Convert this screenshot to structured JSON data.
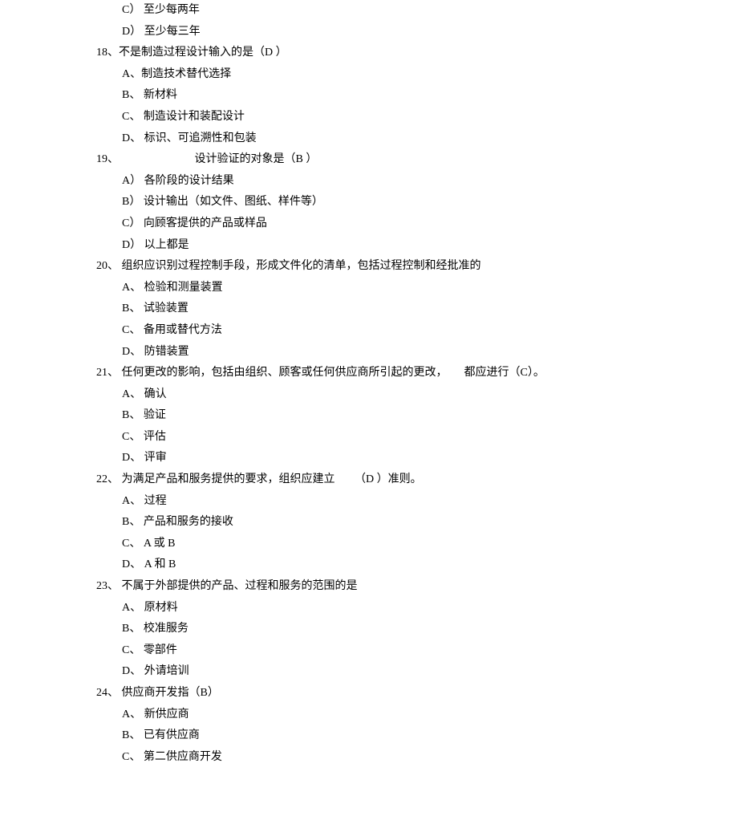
{
  "lines": [
    {
      "cls": "option-pre",
      "text": "C） 至少每两年"
    },
    {
      "cls": "option-pre",
      "text": "D） 至少每三年"
    },
    {
      "cls": "question",
      "text": "18、不是制造过程设计输入的是（D ）"
    },
    {
      "cls": "option",
      "text": "A、制造技术替代选择"
    },
    {
      "cls": "option",
      "text": "B、 新材料"
    },
    {
      "cls": "option",
      "text": "C、 制造设计和装配设计"
    },
    {
      "cls": "option",
      "text": "D、 标识、可追溯性和包装"
    },
    {
      "cls": "question",
      "text": "19、                           设计验证的对象是（B ）"
    },
    {
      "cls": "option",
      "text": "A） 各阶段的设计结果"
    },
    {
      "cls": "option",
      "text": "B） 设计输出（如文件、图纸、样件等）"
    },
    {
      "cls": "option",
      "text": "C） 向顾客提供的产品或样品"
    },
    {
      "cls": "option",
      "text": "D） 以上都是"
    },
    {
      "cls": "question",
      "text": "20、 组织应识别过程控制手段，形成文件化的清单，包括过程控制和经批准的"
    },
    {
      "cls": "option",
      "text": "A、 检验和测量装置"
    },
    {
      "cls": "option",
      "text": "B、 试验装置"
    },
    {
      "cls": "option",
      "text": "C、 备用或替代方法"
    },
    {
      "cls": "option",
      "text": "D、 防错装置"
    },
    {
      "cls": "question",
      "text": "21、 任何更改的影响，包括由组织、顾客或任何供应商所引起的更改，      都应进行（C）。"
    },
    {
      "cls": "option",
      "text": "A、 确认"
    },
    {
      "cls": "option",
      "text": "B、 验证"
    },
    {
      "cls": "option",
      "text": "C、 评估"
    },
    {
      "cls": "option",
      "text": "D、 评审"
    },
    {
      "cls": "question",
      "text": "22、 为满足产品和服务提供的要求，组织应建立       （D ）准则。"
    },
    {
      "cls": "option",
      "text": "A、 过程"
    },
    {
      "cls": "option",
      "text": "B、 产品和服务的接收"
    },
    {
      "cls": "option",
      "text": "C、 A 或 B"
    },
    {
      "cls": "option",
      "text": "D、 A 和 B"
    },
    {
      "cls": "question",
      "text": "23、 不属于外部提供的产品、过程和服务的范围的是"
    },
    {
      "cls": "option",
      "text": "A、 原材料"
    },
    {
      "cls": "option",
      "text": "B、 校准服务"
    },
    {
      "cls": "option",
      "text": "C、 零部件"
    },
    {
      "cls": "option",
      "text": "D、 外请培训"
    },
    {
      "cls": "question",
      "text": "24、 供应商开发指（B）"
    },
    {
      "cls": "option",
      "text": "A、 新供应商"
    },
    {
      "cls": "option",
      "text": "B、 已有供应商"
    },
    {
      "cls": "option",
      "text": "C、 第二供应商开发"
    }
  ]
}
